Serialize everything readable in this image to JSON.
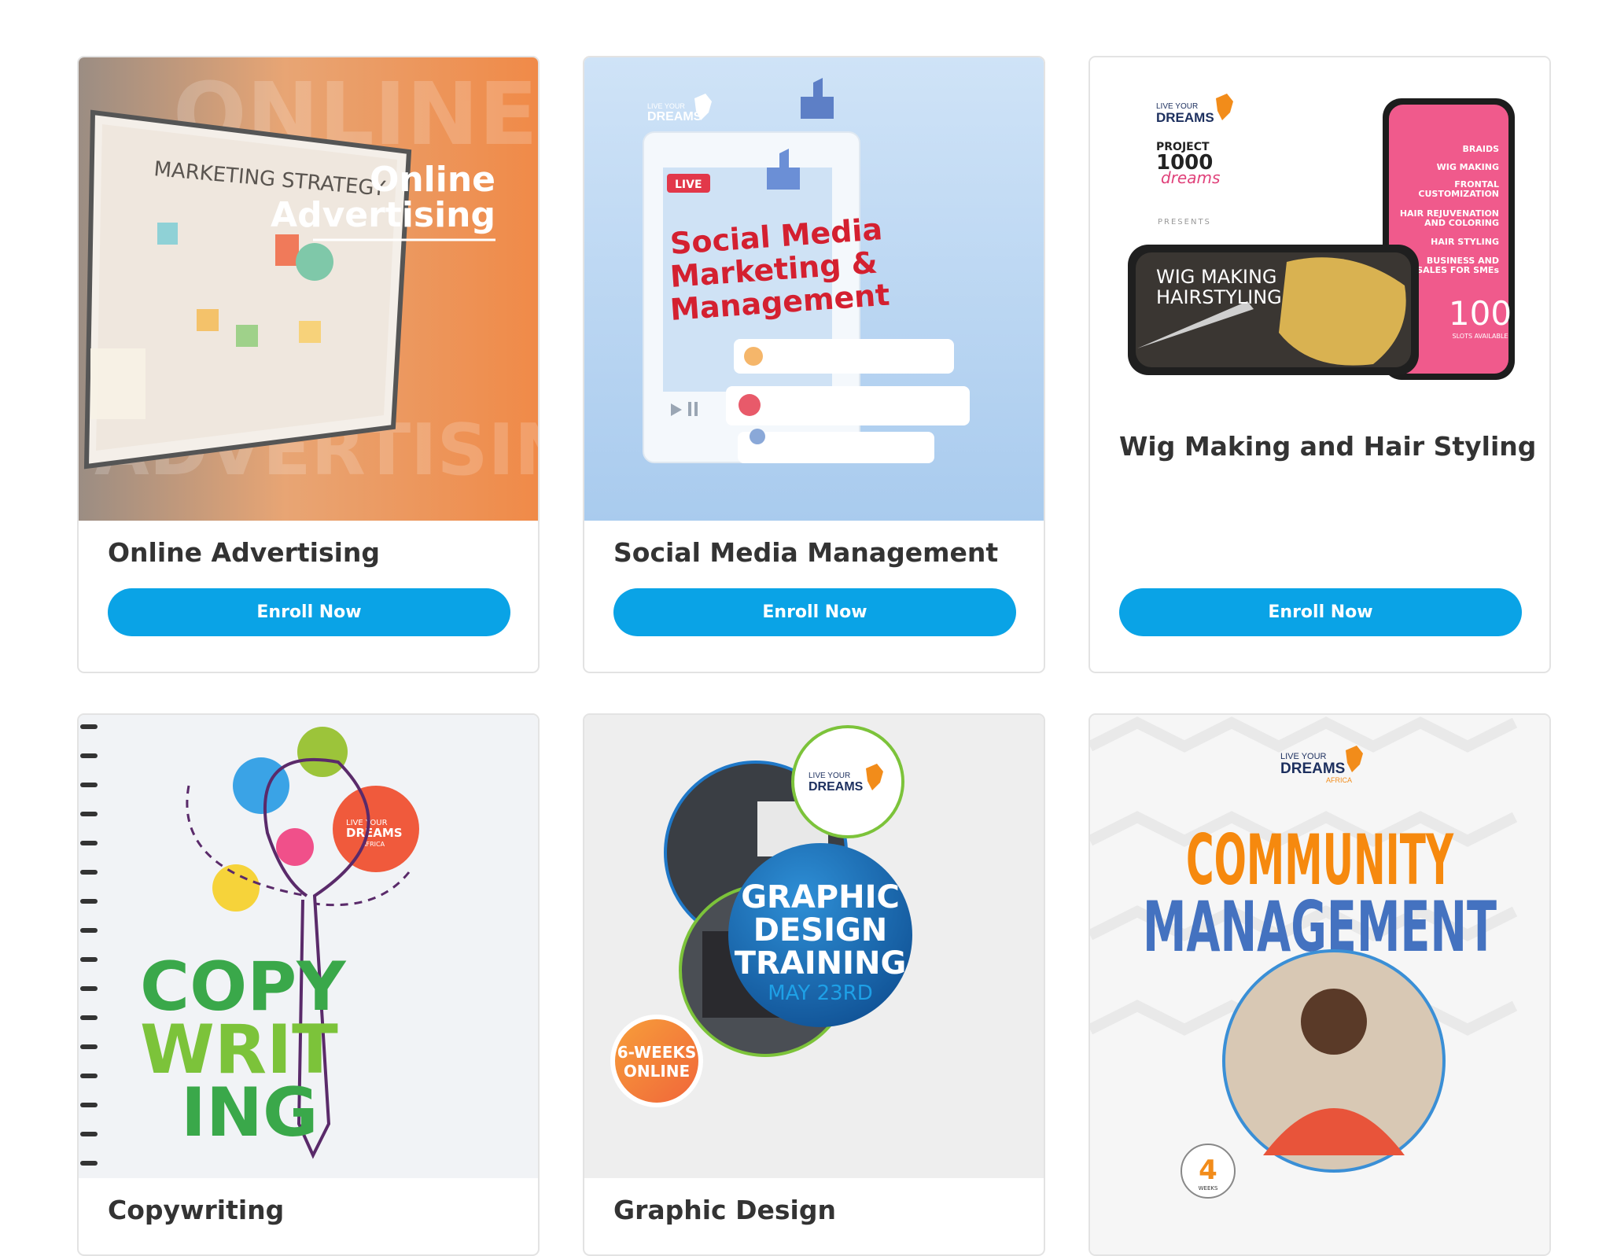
{
  "colors": {
    "accent_button": "#0aa3e6",
    "title_text": "#333333",
    "card_border": "#e3e3e3"
  },
  "courses": [
    {
      "title": "Online Advertising",
      "button": "Enroll Now",
      "image_text": {
        "headline_1": "Online",
        "headline_2": "Advertising",
        "screen": "MARKETING STRATEGY",
        "bg_top": "ONLINE",
        "bg_bottom": "ADVERTISING"
      }
    },
    {
      "title": "Social Media Management",
      "button": "Enroll Now",
      "image_text": {
        "live": "LIVE",
        "line_1": "Social Media",
        "line_2": "Marketing &",
        "line_3": "Management"
      }
    },
    {
      "title": "Wig Making and Hair Styling",
      "button": "Enroll Now",
      "image_text": {
        "logo_1": "LIVE YOUR",
        "logo_2": "DREAMS",
        "project_1": "PROJECT",
        "project_2": "1000",
        "project_3": "dreams",
        "presents": "PRESENTS",
        "phone_1": "WIG MAKING",
        "phone_2": "HAIRSTYLING",
        "list": [
          "BRAIDS",
          "WIG MAKING",
          "FRONTAL",
          "CUSTOMIZATION",
          "HAIR REJUVENATION",
          "AND COLORING",
          "HAIR STYLING",
          "BUSINESS AND",
          "SALES FOR SMEs"
        ],
        "slots_number": "100",
        "slots_label": "SLOTS AVAILABLE"
      }
    },
    {
      "title": "Copywriting",
      "image_text": {
        "line_1": "COPY",
        "line_2": "WRIT",
        "line_3": "ING",
        "logo_1": "LIVE YOUR",
        "logo_2": "DREAMS",
        "logo_3": "AFRICA"
      }
    },
    {
      "title": "Graphic Design",
      "image_text": {
        "line_1": "GRAPHIC",
        "line_2": "DESIGN",
        "line_3": "TRAINING",
        "date": "MAY 23RD",
        "weeks_1": "6-WEEKS",
        "weeks_2": "ONLINE",
        "logo_1": "LIVE YOUR",
        "logo_2": "DREAMS"
      }
    },
    {
      "title": "Community Management",
      "image_text": {
        "line_1": "COMMUNITY",
        "line_2": "MANAGEMENT",
        "logo_1": "LIVE YOUR",
        "logo_2": "DREAMS",
        "logo_3": "AFRICA",
        "weeks_number": "4",
        "weeks_label": "WEEKS"
      }
    }
  ]
}
